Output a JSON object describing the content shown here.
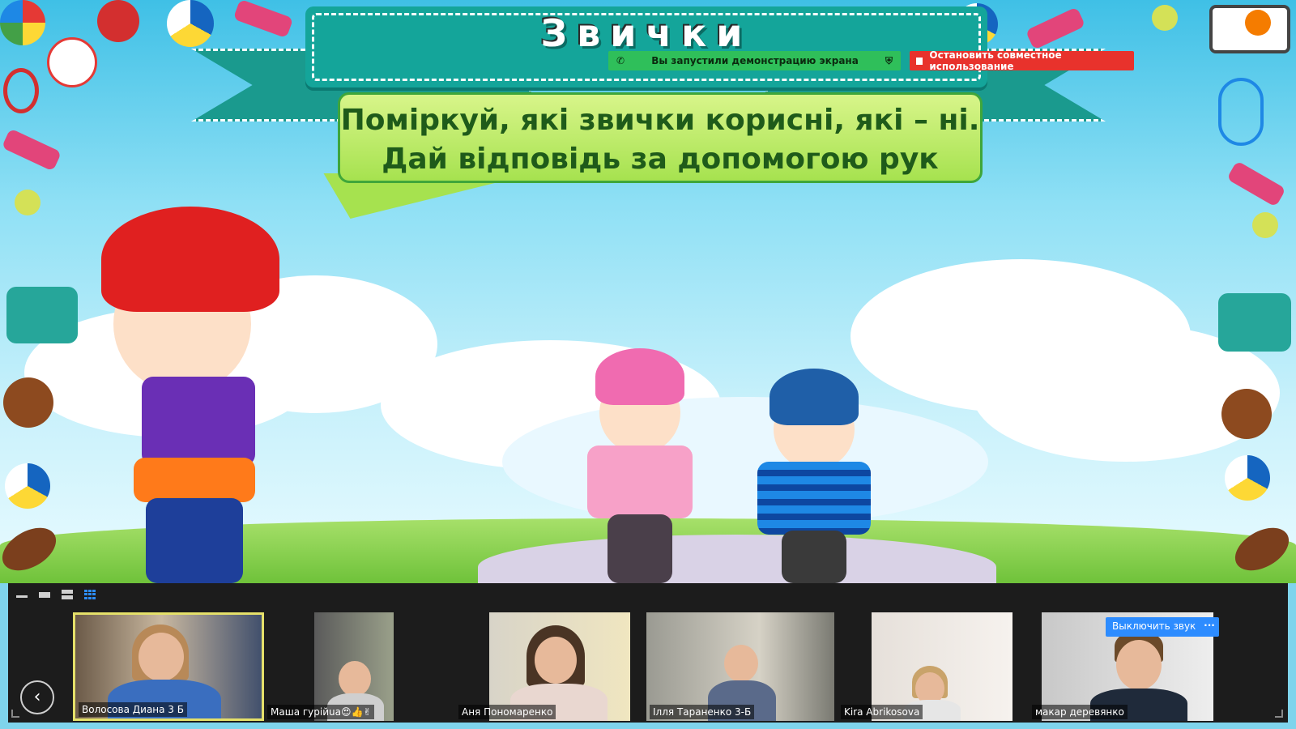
{
  "slide": {
    "title": "Звички",
    "instruction_line1": "Поміркуй, які звички корисні, які – ні.",
    "instruction_line2": "Дай відповідь за допомогою рук"
  },
  "screen_share": {
    "status_text": "Вы запустили демонстрацию экрана",
    "stop_label": "Остановить совместное использование"
  },
  "gallery": {
    "layout_icons": [
      "minimize-icon",
      "speaker-view-icon",
      "split-view-icon",
      "gallery-view-icon"
    ],
    "participants": [
      {
        "name": "Волосова Диана 3 Б",
        "active": true
      },
      {
        "name": "Маша гурійuа😍👍✌"
      },
      {
        "name": "Аня Пономаренко"
      },
      {
        "name": "Ілля Тараненко 3-Б"
      },
      {
        "name": "Kira Abrikosova"
      },
      {
        "name": "макар деревянко"
      }
    ],
    "mute_label": "Выключить звук",
    "more_label": "···",
    "prev_label": "‹"
  },
  "colors": {
    "share_green": "#2fbf5a",
    "stop_red": "#e8322c",
    "zoom_blue": "#2d8cff",
    "banner_teal": "#14a59a"
  }
}
